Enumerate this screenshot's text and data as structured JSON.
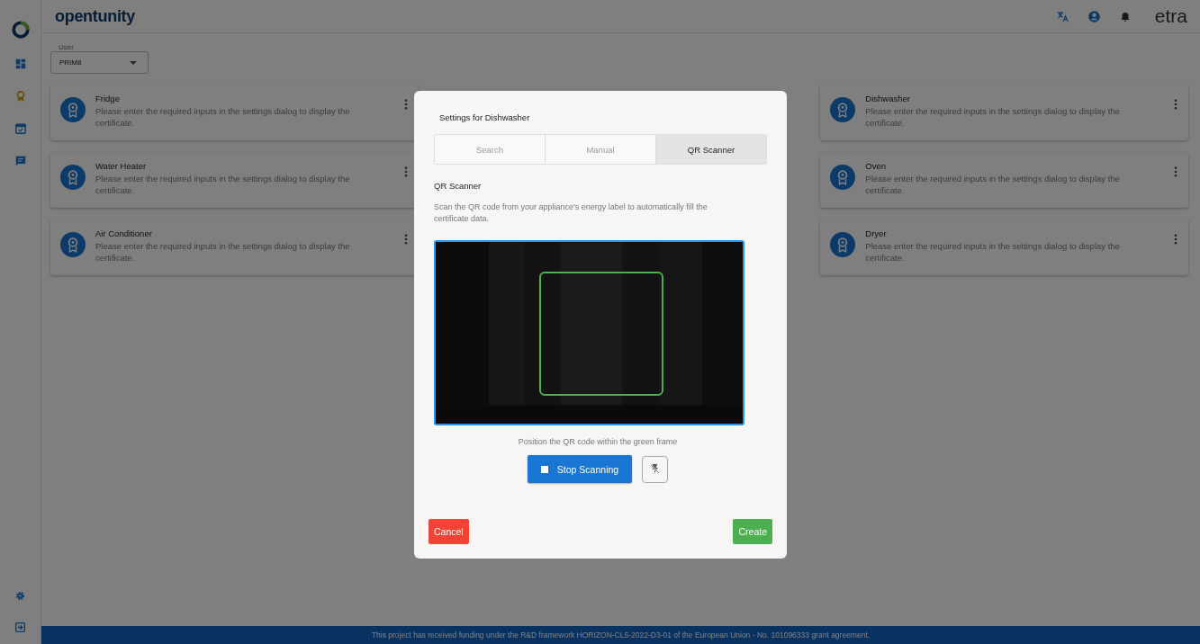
{
  "header": {
    "brand": "opentunity",
    "partner": "etra"
  },
  "sidebar": {
    "items": [
      {
        "kind": "dashboard",
        "selected": false
      },
      {
        "kind": "certificate",
        "selected": true
      },
      {
        "kind": "calendar",
        "selected": false
      },
      {
        "kind": "chat",
        "selected": false
      }
    ]
  },
  "user_select": {
    "label": "User",
    "value": "PRIM8"
  },
  "left_cards": [
    {
      "title": "Fridge",
      "text": "Please enter the required inputs in the settings dialog to display the certificate."
    },
    {
      "title": "Water Heater",
      "text": "Please enter the required inputs in the settings dialog to display the certificate."
    },
    {
      "title": "Air Conditioner",
      "text": "Please enter the required inputs in the settings dialog to display the certificate."
    }
  ],
  "right_cards": [
    {
      "title": "Dishwasher",
      "text": "Please enter the required inputs in the settings dialog to display the certificate."
    },
    {
      "title": "Oven",
      "text": "Please enter the required inputs in the settings dialog to display the certificate."
    },
    {
      "title": "Dryer",
      "text": "Please enter the required inputs in the settings dialog to display the certificate."
    }
  ],
  "dialog": {
    "title": "Settings for Dishwasher",
    "tabs": [
      {
        "label": "Search",
        "selected": false
      },
      {
        "label": "Manual",
        "selected": false
      },
      {
        "label": "QR Scanner",
        "selected": true
      }
    ],
    "section_title": "QR Scanner",
    "description": "Scan the QR code from your appliance's energy label to automatically fill the certificate data.",
    "hint": "Position the QR code within the green frame",
    "stop_button": "Stop Scanning",
    "cancel": "Cancel",
    "create": "Create"
  },
  "footer": "This project has received funding under the R&D framework HORIZON-CL5-2022-D3-01 of the European Union - No. 101096333 grant agreement."
}
